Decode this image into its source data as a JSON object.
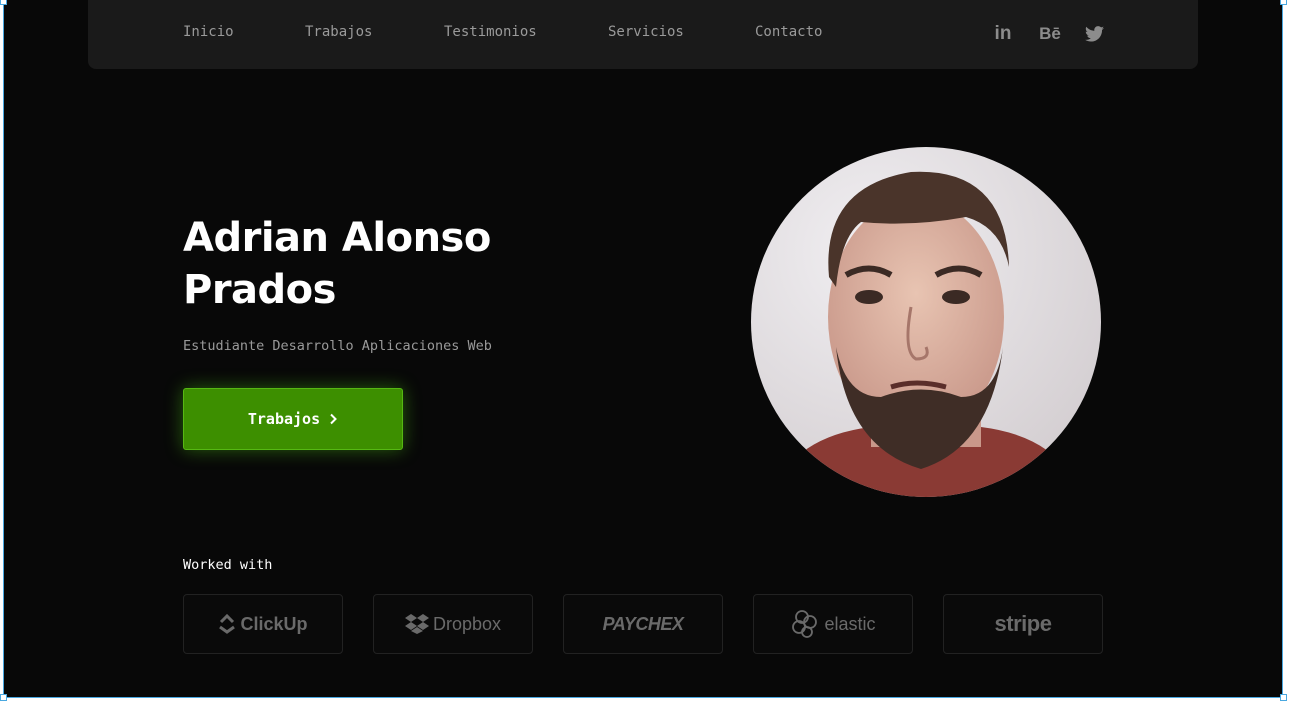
{
  "nav": {
    "links": [
      "Inicio",
      "Trabajos",
      "Testimonios",
      "Servicios",
      "Contacto"
    ],
    "social": [
      "linkedin-icon",
      "behance-icon",
      "twitter-icon"
    ],
    "social_labels": {
      "linkedin": "in",
      "behance": "Bē"
    }
  },
  "hero": {
    "name_line1": "Adrian Alonso",
    "name_line2": "Prados",
    "subtitle": "Estudiante Desarrollo Aplicaciones Web",
    "cta_label": "Trabajos",
    "cta_icon": "chevron-right-icon"
  },
  "worked_with": {
    "heading": "Worked with",
    "logos": [
      "ClickUp",
      "Dropbox",
      "PAYCHEX",
      "elastic",
      "stripe"
    ]
  },
  "colors": {
    "background": "#080808",
    "nav_bg": "#1a1a1a",
    "accent": "#3d8f00",
    "text_muted": "#9a9a9a"
  }
}
